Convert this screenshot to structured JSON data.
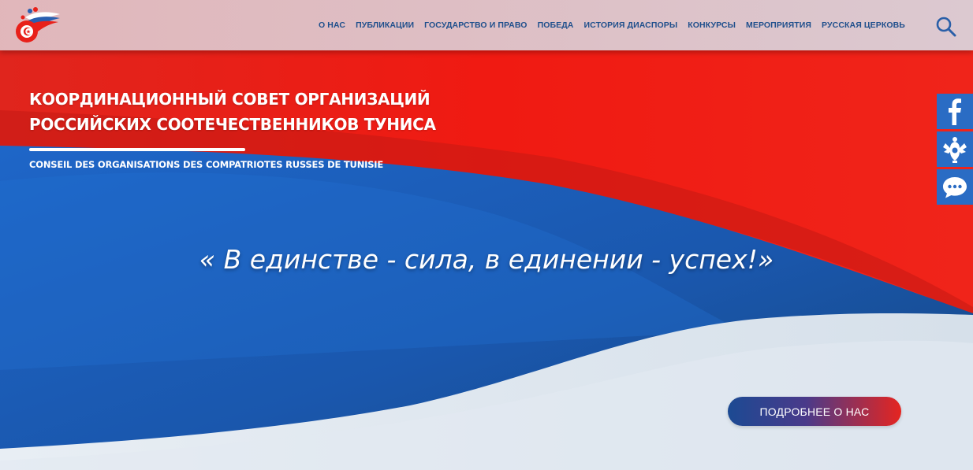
{
  "nav": {
    "items": [
      "О НАС",
      "ПУБЛИКАЦИИ",
      "ГОСУДАРСТВО И ПРАВО",
      "ПОБЕДА",
      "ИСТОРИЯ ДИАСПОРЫ",
      "КОНКУРСЫ",
      "МЕРОПРИЯТИЯ",
      "РУССКАЯ ЦЕРКОВЬ"
    ]
  },
  "icons": {
    "logo": "council-logo",
    "search": "search-icon",
    "facebook": "facebook-icon",
    "emblem": "russian-emblem-icon",
    "chat": "chat-icon"
  },
  "hero": {
    "title_line1": "КООРДИНАЦИОННЫЙ СОВЕТ ОРГАНИЗАЦИЙ",
    "title_line2": "РОССИЙСКИХ СООТЕЧЕСТВЕННИКОВ ТУНИСА",
    "subtitle": "CONSEIL DES ORGANISATIONS DES COMPATRIOTES RUSSES DE TUNISIE",
    "quote": "« В единстве - сила, в единении - успех!»",
    "button_label": "ПОДРОБНЕЕ О НАС"
  },
  "colors": {
    "red": "#e8201a",
    "blue": "#1b5fb8",
    "light": "#dce6ef",
    "nav_text": "#1f4f8c"
  }
}
